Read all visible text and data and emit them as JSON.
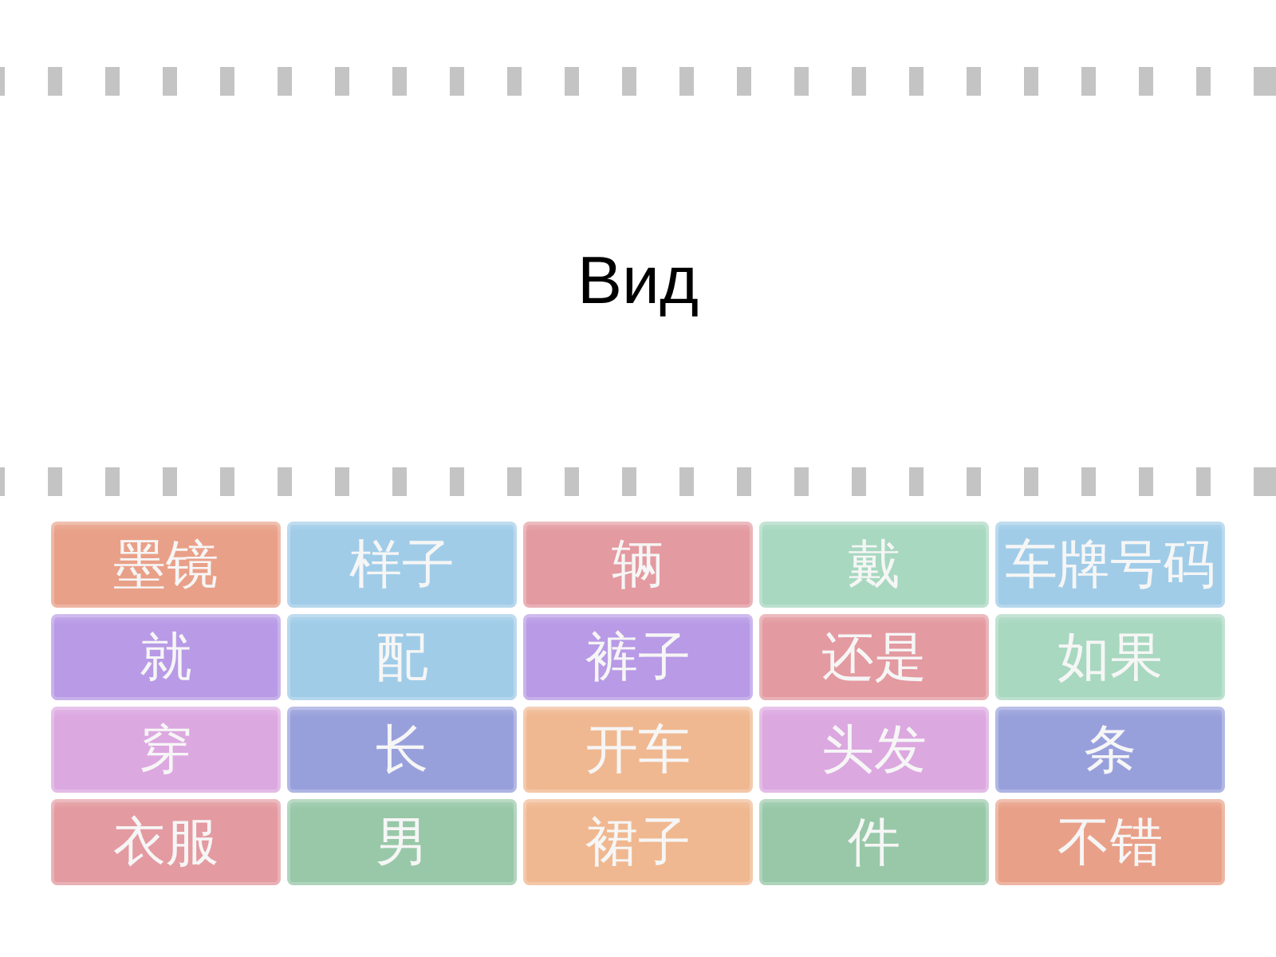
{
  "title": "Вид",
  "tiles": [
    {
      "label": "墨镜",
      "color": "#e9a088"
    },
    {
      "label": "样子",
      "color": "#a0cce8"
    },
    {
      "label": "辆",
      "color": "#e39aa0"
    },
    {
      "label": "戴",
      "color": "#a8d8c0"
    },
    {
      "label": "车牌号码",
      "color": "#a0cce8"
    },
    {
      "label": "就",
      "color": "#b89ae6"
    },
    {
      "label": "配",
      "color": "#a0cce8"
    },
    {
      "label": "裤子",
      "color": "#b89ae6"
    },
    {
      "label": "还是",
      "color": "#e39aa0"
    },
    {
      "label": "如果",
      "color": "#a8d8c0"
    },
    {
      "label": "穿",
      "color": "#dca8e0"
    },
    {
      "label": "长",
      "color": "#98a0dc"
    },
    {
      "label": "开车",
      "color": "#f0b890"
    },
    {
      "label": "头发",
      "color": "#dca8e0"
    },
    {
      "label": "条",
      "color": "#98a0dc"
    },
    {
      "label": "衣服",
      "color": "#e39aa0"
    },
    {
      "label": "男",
      "color": "#98c8a8"
    },
    {
      "label": "裙子",
      "color": "#f0b890"
    },
    {
      "label": "件",
      "color": "#98c8a8"
    },
    {
      "label": "不错",
      "color": "#e9a088"
    }
  ]
}
